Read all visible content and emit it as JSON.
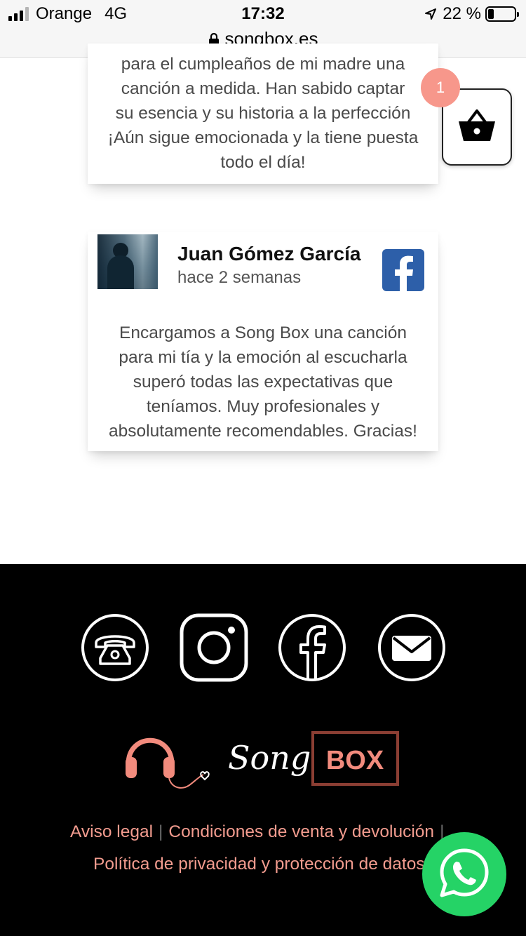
{
  "status_bar": {
    "carrier": "Orange",
    "network": "4G",
    "time": "17:32",
    "battery_percent": "22 %",
    "battery_level": 0.22,
    "signal_bars": 3,
    "icons": [
      "signal-icon",
      "location-arrow-icon",
      "battery-icon",
      "lock-icon"
    ]
  },
  "browser": {
    "domain": "songbox.es"
  },
  "reviews": [
    {
      "text_lines": [
        "para el cumpleaños de mi madre una",
        "canción a medida. Han sabido captar",
        "su esencia y su historia a la perfección",
        "¡Aún sigue emocionada y la tiene puesta",
        "todo el día!"
      ]
    },
    {
      "name": "Juan Gómez García",
      "date": "hace 2 semanas",
      "source_icon": "facebook-icon",
      "text_lines": [
        "Encargamos a Song Box una canción",
        "para mi tía y la emoción al escucharla",
        "superó todas las expectativas que",
        "teníamos. Muy profesionales y",
        "absolutamente recomendables. Gracias!"
      ]
    }
  ],
  "cart": {
    "count": "1",
    "icon": "basket-icon"
  },
  "footer": {
    "social_icons": [
      "phone-icon",
      "instagram-icon",
      "facebook-icon",
      "email-icon"
    ],
    "logo": {
      "script_text": "Song",
      "box_text": "BOX"
    },
    "links": {
      "legal": "Aviso legal",
      "sep": "|",
      "conditions": "Condiciones de venta y devolución",
      "privacy": "Política de privacidad y protección de datos"
    }
  },
  "colors": {
    "accent": "#f39c8f",
    "cart_badge": "#f7978b",
    "logo_box": "#8b3e33",
    "facebook": "#2d5fa9",
    "whatsapp": "#25d366"
  },
  "whatsapp": {
    "icon": "whatsapp-icon"
  }
}
